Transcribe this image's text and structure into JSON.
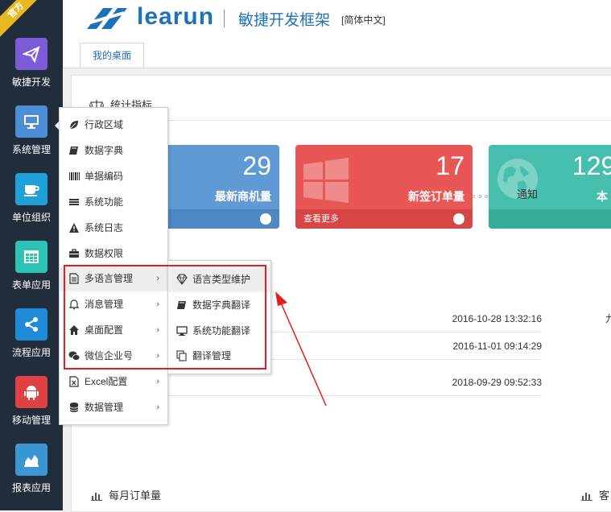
{
  "sidebar": {
    "badge": "官方",
    "items": [
      {
        "label": "敏捷开发",
        "icon": "paper-plane-icon",
        "color": "#7c5bd6"
      },
      {
        "label": "系统管理",
        "icon": "monitor-icon",
        "color": "#4d8fd6"
      },
      {
        "label": "单位组织",
        "icon": "coffee-cup-icon",
        "color": "#1fa0d8"
      },
      {
        "label": "表单应用",
        "icon": "table-icon",
        "color": "#2bc3b4"
      },
      {
        "label": "流程应用",
        "icon": "share-icon",
        "color": "#1f8ad6"
      },
      {
        "label": "移动管理",
        "icon": "android-icon",
        "color": "#e0403f"
      },
      {
        "label": "报表应用",
        "icon": "area-chart-icon",
        "color": "#3a97d4"
      }
    ]
  },
  "header": {
    "logo_text": "learun",
    "subtitle": "敏捷开发框架",
    "lang": "[简体中文]"
  },
  "tabs": [
    {
      "label": "我的桌面"
    }
  ],
  "main": {
    "stats_title": "统计指标",
    "cards": [
      {
        "value": "29",
        "label": "最新商机量",
        "footer": "",
        "color": "#5f9ad4",
        "foot_color": "#4d88c4"
      },
      {
        "value": "17",
        "label": "新签订单量",
        "footer": "查看更多",
        "color": "#e85656",
        "foot_color": "#d84545"
      },
      {
        "value": "129",
        "label": "本",
        "footer": "",
        "color": "#47bfae",
        "foot_color": "#37ad9c"
      }
    ],
    "notice_more": "。。。",
    "notice_title": "通知",
    "list": [
      {
        "date": "2016-10-28 13:32:16"
      },
      {
        "date": "2016-11-01 09:14:29"
      },
      {
        "date": "2018-09-29 09:52:33"
      }
    ],
    "list_trailing": "九",
    "bottom_left_title": "每月订单量",
    "bottom_right_title": "客"
  },
  "menu": {
    "items": [
      {
        "label": "行政区域",
        "icon": "leaf-icon",
        "has_sub": false
      },
      {
        "label": "数据字典",
        "icon": "book-icon",
        "has_sub": false
      },
      {
        "label": "单据编码",
        "icon": "barcode-icon",
        "has_sub": false
      },
      {
        "label": "系统功能",
        "icon": "list-icon",
        "has_sub": false
      },
      {
        "label": "系统日志",
        "icon": "warning-icon",
        "has_sub": false
      },
      {
        "label": "数据权限",
        "icon": "briefcase-icon",
        "has_sub": false
      },
      {
        "label": "多语言管理",
        "icon": "file-text-icon",
        "has_sub": true
      },
      {
        "label": "消息管理",
        "icon": "bell-icon",
        "has_sub": true
      },
      {
        "label": "桌面配置",
        "icon": "home-icon",
        "has_sub": true
      },
      {
        "label": "微信企业号",
        "icon": "wechat-icon",
        "has_sub": true
      },
      {
        "label": "Excel配置",
        "icon": "excel-icon",
        "has_sub": true
      },
      {
        "label": "数据管理",
        "icon": "database-icon",
        "has_sub": true
      }
    ],
    "chevron": "›"
  },
  "submenu": {
    "items": [
      {
        "label": "语言类型维护",
        "icon": "diamond-icon"
      },
      {
        "label": "数据字典翻译",
        "icon": "book-icon"
      },
      {
        "label": "系统功能翻译",
        "icon": "monitor-icon"
      },
      {
        "label": "翻译管理",
        "icon": "copy-icon"
      }
    ]
  },
  "colors": {
    "highlight": "#e41e1e",
    "brand": "#1e72b8",
    "sidebar_bg": "#222d3c"
  }
}
